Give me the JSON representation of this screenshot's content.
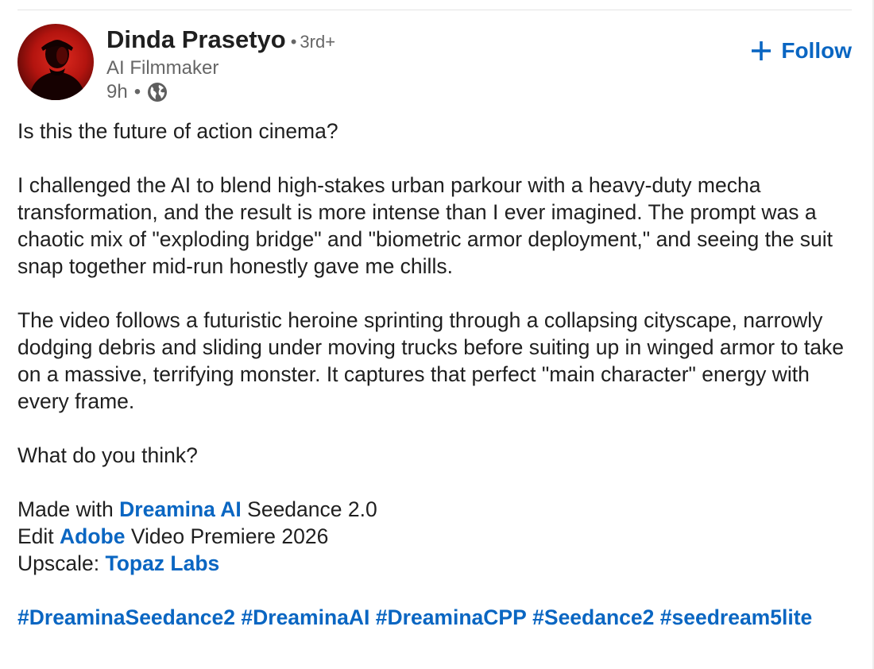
{
  "author": {
    "name": "Dinda Prasetyo",
    "degree_sep": "•",
    "degree": "3rd+",
    "headline": "AI Filmmaker",
    "time": "9h",
    "meta_sep": "•",
    "visibility_icon": "globe-icon",
    "avatar_icon": "profile-photo"
  },
  "follow": {
    "icon": "plus-icon",
    "label": "Follow"
  },
  "post": {
    "p1": "Is this the future of action cinema?",
    "p2": "I challenged the AI to blend high-stakes urban parkour with a heavy-duty mecha transformation, and the result is more intense than I ever imagined. The prompt was a chaotic mix of \"exploding bridge\" and \"biometric armor deployment,\" and seeing the suit snap together mid-run honestly gave me chills.",
    "p3": "The video follows a futuristic heroine sprinting through a collapsing cityscape, narrowly dodging debris and sliding under moving trucks before suiting up in winged armor to take on a massive, terrifying monster. It captures that perfect \"main character\" energy with every frame.",
    "p4": "What do you think?",
    "credits": {
      "made_prefix": "Made with ",
      "made_link": "Dreamina AI",
      "made_suffix": " Seedance 2.0",
      "edit_prefix": "Edit ",
      "edit_link": "Adobe",
      "edit_suffix": " Video Premiere 2026",
      "upscale_prefix": "Upscale: ",
      "upscale_link": "Topaz Labs"
    },
    "hashtags": [
      "#DreaminaSeedance2",
      "#DreaminaAI",
      "#DreaminaCPP",
      "#Seedance2",
      "#seedream5lite"
    ]
  },
  "colors": {
    "link": "#0a66c2",
    "text": "#1f1f1f",
    "muted": "#666666"
  }
}
